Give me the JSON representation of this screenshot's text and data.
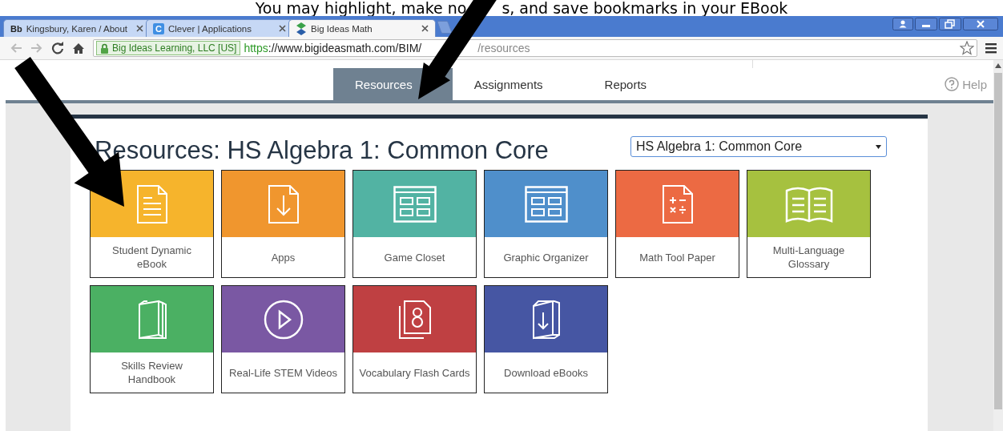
{
  "caption": {
    "part_1": "You may highlight, make no",
    "part_2": "s, and save bookmarks in your EBook"
  },
  "browser_tabs": [
    {
      "favicon_text": "Bb",
      "title": "Kingsbury, Karen / About",
      "selected": false
    },
    {
      "favicon_text": "C",
      "title": "Clever | Applications",
      "selected": false
    },
    {
      "title": "Big Ideas Math",
      "selected": true
    }
  ],
  "address_bar": {
    "security_label": "Big Ideas Learning, LLC [US]",
    "scheme": "https",
    "url_start": "://www.bigideasmath.com/BIM/",
    "url_end": "/resources"
  },
  "nav": [
    {
      "label": "Resources",
      "selected": true
    },
    {
      "label": "Assignments",
      "selected": false
    },
    {
      "label": "Reports",
      "selected": false
    }
  ],
  "help": "Help",
  "page_title": "Resources: HS Algebra 1: Common Core",
  "course_select": {
    "value": "HS Algebra 1: Common Core"
  },
  "tiles": [
    {
      "label": "Student Dynamic\neBook",
      "color": "#f6b42c"
    },
    {
      "label": "Apps",
      "color": "#f0962e"
    },
    {
      "label": "Game Closet",
      "color": "#52b3a3"
    },
    {
      "label": "Graphic Organizer",
      "color": "#4f8fcb"
    },
    {
      "label": "Math Tool Paper",
      "color": "#ec6a43"
    },
    {
      "label": "Multi-Language\nGlossary",
      "color": "#a6c13f"
    },
    {
      "label": "Skills Review\nHandbook",
      "color": "#4bb063"
    },
    {
      "label": "Real-Life STEM Videos",
      "color": "#7a58a3"
    },
    {
      "label": "Vocabulary Flash Cards",
      "color": "#bf4042"
    },
    {
      "label": "Download eBooks",
      "color": "#4656a3"
    }
  ]
}
